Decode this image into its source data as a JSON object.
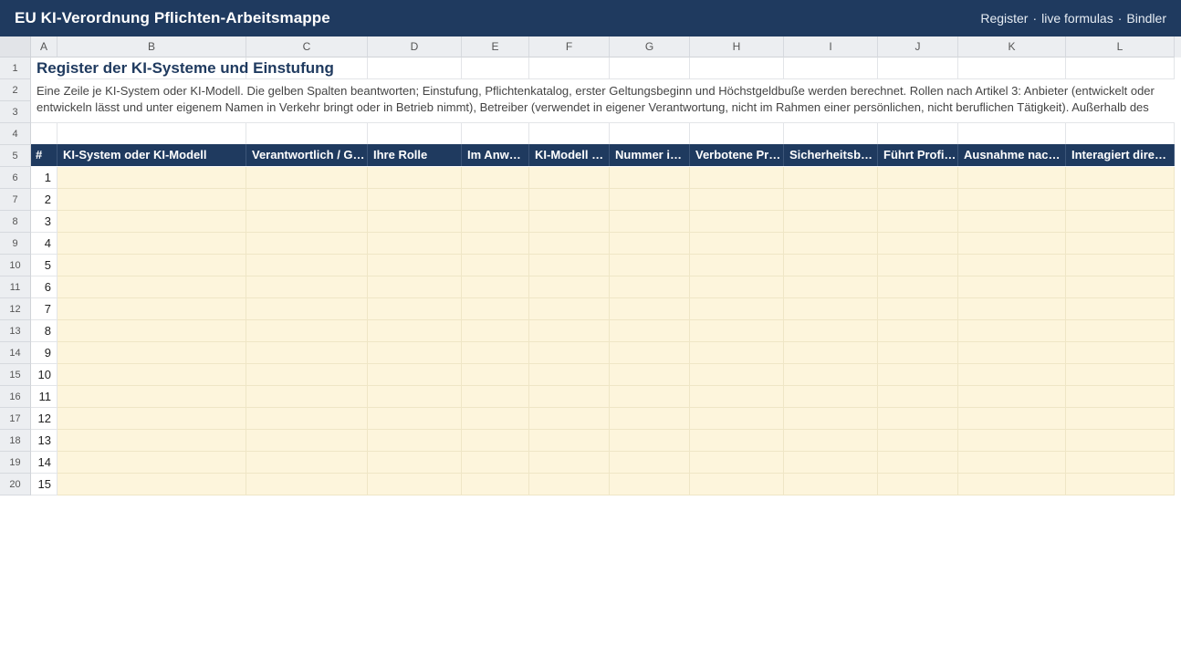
{
  "app": {
    "title": "EU KI-Verordnung Pflichten-Arbeitsmappe",
    "links": [
      "Register",
      "live formulas",
      "Bindler"
    ],
    "separator": "·"
  },
  "columns": [
    "A",
    "B",
    "C",
    "D",
    "E",
    "F",
    "G",
    "H",
    "I",
    "J",
    "K",
    "L"
  ],
  "row_numbers": [
    "1",
    "2",
    "3",
    "4",
    "5",
    "6",
    "7",
    "8",
    "9",
    "10",
    "11",
    "12",
    "13",
    "14",
    "15",
    "16",
    "17",
    "18",
    "19",
    "20"
  ],
  "sheet": {
    "title": "Register der KI-Systeme und Einstufung",
    "description": "Eine Zeile je KI-System oder KI-Modell. Die gelben Spalten beantworten; Einstufung, Pflichtenkatalog, erster Geltungsbeginn und Höchstgeldbuße werden berechnet. Rollen nach Artikel 3: Anbieter (entwickelt oder entwickeln lässt und unter eigenem Namen in Verkehr bringt oder in Betrieb nimmt), Betreiber (verwendet in eigener Verantwortung, nicht im Rahmen einer persönlichen, nicht beruflichen Tätigkeit). Außerhalb des",
    "headers": [
      "#",
      "KI-System oder KI-Modell",
      "Verantwortlich / G…",
      "Ihre Rolle",
      "Im Anw…",
      "KI-Modell …",
      "Nummer i…",
      "Verbotene Pr…",
      "Sicherheitsb…",
      "Führt Profi…",
      "Ausnahme nac…",
      "Interagiert dire…"
    ],
    "row_indices": [
      "1",
      "2",
      "3",
      "4",
      "5",
      "6",
      "7",
      "8",
      "9",
      "10",
      "11",
      "12",
      "13",
      "14",
      "15"
    ]
  },
  "colors": {
    "titlebar": "#1f3a5f",
    "header_fill": "#1f3a5f",
    "input_fill": "#fdf5dc"
  }
}
